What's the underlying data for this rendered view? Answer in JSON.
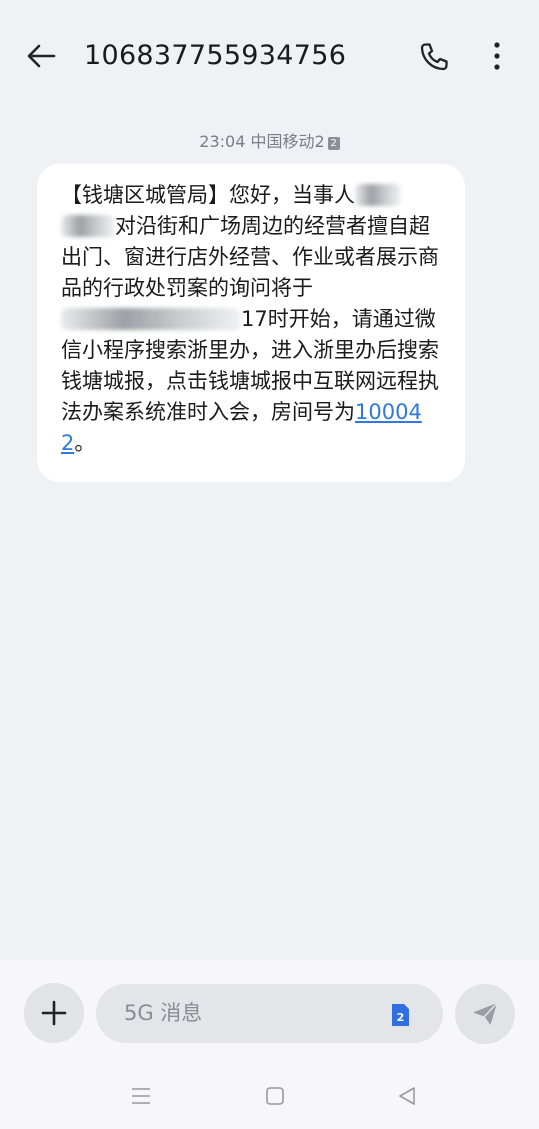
{
  "header": {
    "sender_number": "106837755934756",
    "back_icon": "arrow-left-icon",
    "call_icon": "phone-icon",
    "more_icon": "more-vertical-icon"
  },
  "thread": {
    "timestamp": "23:04",
    "carrier": "中国移动2",
    "sim_badge": "2"
  },
  "message": {
    "part1": "【钱塘区城管局】您好，当事人",
    "part2": "对沿街和广场周边的经营者擅自超出门、窗进行店外经营、作业或者展示商品的行政处罚案的询问将于",
    "part3": "17时开始，请通过微信小程序搜索浙里办，进入浙里办后搜索钱塘城报，点击钱塘城报中互联网远程执法办案系统准时入会，房间号为",
    "room_code": "100042",
    "part4": "。"
  },
  "compose": {
    "placeholder": "5G 消息",
    "sim_label": "2"
  },
  "colors": {
    "background": "#f0f1f5",
    "bubble": "#ffffff",
    "link": "#2f79d8",
    "sim_blue": "#2f6fe0"
  }
}
